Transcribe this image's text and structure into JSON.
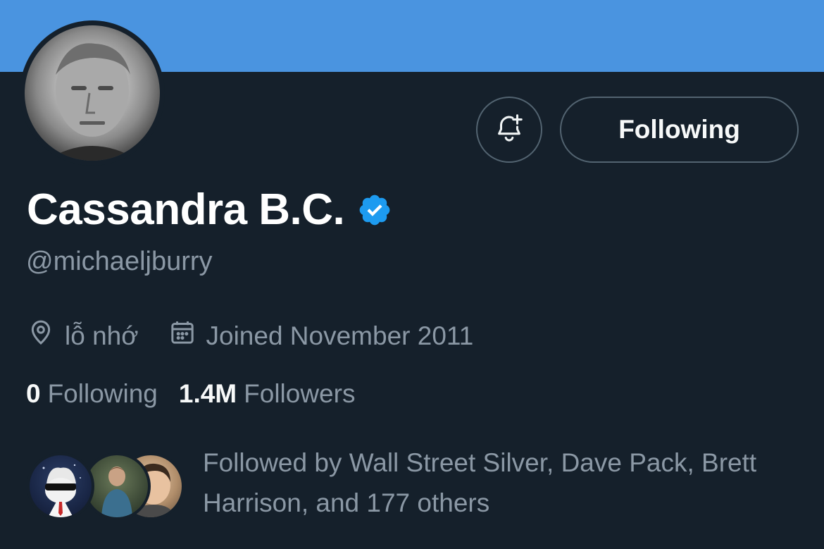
{
  "profile": {
    "display_name": "Cassandra B.C.",
    "handle": "@michaeljburry",
    "location": "lỗ nhớ",
    "joined": "Joined November 2011",
    "following_count": "0",
    "following_label": "Following",
    "followers_count": "1.4M",
    "followers_label": "Followers",
    "followed_by_text": "Followed by Wall Street Silver, Dave Pack, Brett Harrison, and 177 others"
  },
  "actions": {
    "following_button_label": "Following"
  },
  "colors": {
    "banner": "#4a94e0",
    "background": "#15202b",
    "verified_badge": "#1d9bf0",
    "muted_text": "#8b98a5"
  },
  "icons": [
    "notification-bell-plus-icon",
    "verified-badge-icon",
    "location-pin-icon",
    "calendar-icon"
  ]
}
